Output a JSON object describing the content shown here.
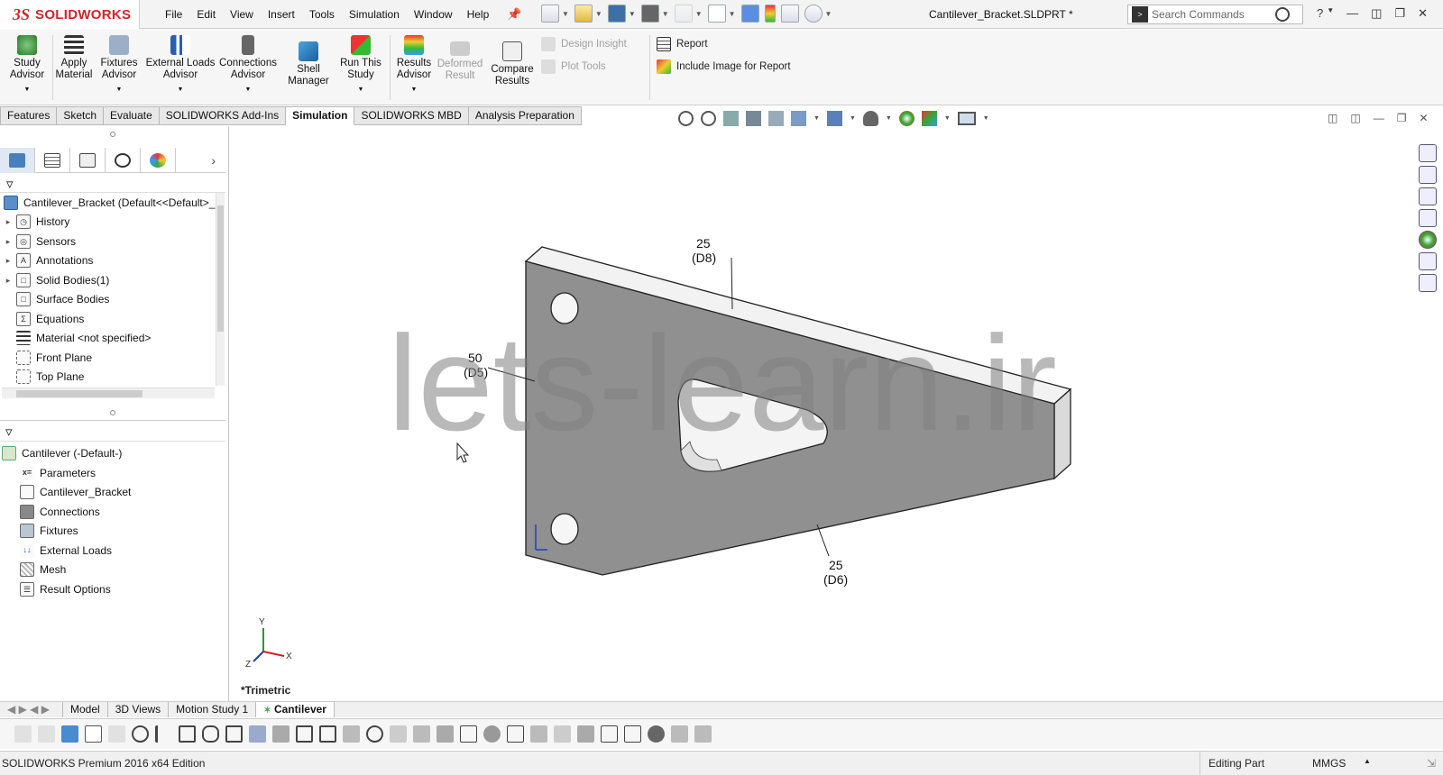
{
  "app": {
    "brand_prefix": "3S",
    "brand": "SOLIDWORKS",
    "doc_title": "Cantilever_Bracket.SLDPRT *"
  },
  "menu": [
    "File",
    "Edit",
    "View",
    "Insert",
    "Tools",
    "Simulation",
    "Window",
    "Help"
  ],
  "search": {
    "placeholder": "Search Commands"
  },
  "ribbon": {
    "study_advisor": [
      "Study",
      "Advisor"
    ],
    "apply_material": [
      "Apply",
      "Material"
    ],
    "fixtures_advisor": [
      "Fixtures",
      "Advisor"
    ],
    "external_loads_advisor": [
      "External Loads",
      "Advisor"
    ],
    "connections_advisor": [
      "Connections",
      "Advisor"
    ],
    "shell_manager": [
      "Shell",
      "Manager"
    ],
    "run_this_study": [
      "Run This",
      "Study"
    ],
    "results_advisor": [
      "Results",
      "Advisor"
    ],
    "deformed_result": [
      "Deformed",
      "Result"
    ],
    "compare_results": [
      "Compare",
      "Results"
    ],
    "design_insight": "Design Insight",
    "plot_tools": "Plot Tools",
    "report": "Report",
    "include_image": "Include Image for Report"
  },
  "tabs": [
    "Features",
    "Sketch",
    "Evaluate",
    "SOLIDWORKS Add-Ins",
    "Simulation",
    "SOLIDWORKS MBD",
    "Analysis Preparation"
  ],
  "active_tab": "Simulation",
  "feature_tree": {
    "root": "Cantilever_Bracket  (Default<<Default>_",
    "items": [
      {
        "label": "History",
        "expandable": true
      },
      {
        "label": "Sensors",
        "expandable": true
      },
      {
        "label": "Annotations",
        "expandable": true
      },
      {
        "label": "Solid Bodies(1)",
        "expandable": true
      },
      {
        "label": "Surface Bodies",
        "expandable": false
      },
      {
        "label": "Equations",
        "expandable": false
      },
      {
        "label": "Material <not specified>",
        "expandable": false
      },
      {
        "label": "Front Plane",
        "expandable": false
      },
      {
        "label": "Top Plane",
        "expandable": false
      }
    ]
  },
  "sim_tree": {
    "root": "Cantilever (-Default-)",
    "items": [
      "Parameters",
      "Cantilever_Bracket",
      "Connections",
      "Fixtures",
      "External Loads",
      "Mesh",
      "Result Options"
    ]
  },
  "viewport": {
    "view_label": "*Trimetric",
    "watermark": "lets-learn.ir",
    "dims": [
      {
        "value": "25",
        "name": "(D8)"
      },
      {
        "value": "50",
        "name": "(D5)"
      },
      {
        "value": "25",
        "name": "(D6)"
      }
    ],
    "triad": {
      "x": "X",
      "y": "Y",
      "z": "Z"
    }
  },
  "bottom_tabs": [
    "Model",
    "3D Views",
    "Motion Study 1",
    "Cantilever"
  ],
  "active_bottom_tab": "Cantilever",
  "status": {
    "edition": "SOLIDWORKS Premium 2016 x64 Edition",
    "mode": "Editing Part",
    "units": "MMGS"
  },
  "colors": {
    "brand_red": "#d2232a",
    "part_gray": "#909090",
    "accent_blue": "#1a6fc9"
  }
}
